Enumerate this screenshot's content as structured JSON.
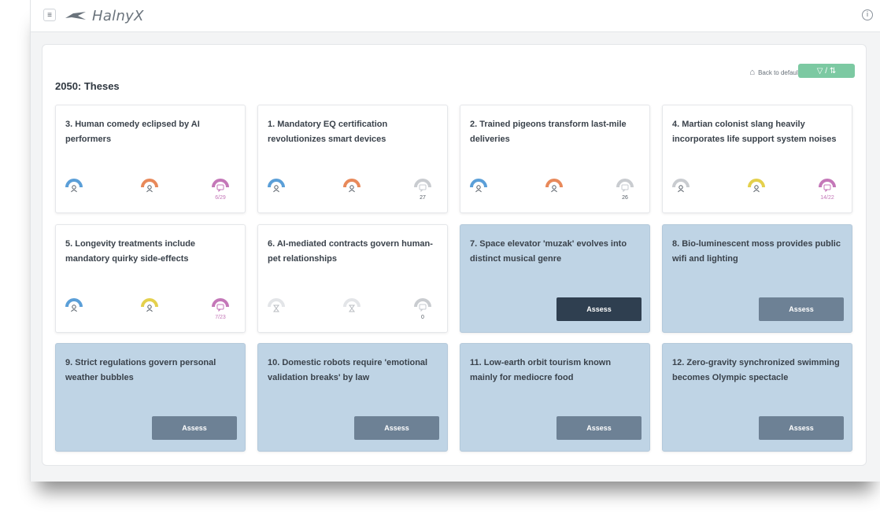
{
  "app": {
    "name": "HalnyX"
  },
  "panel": {
    "title": "2050: Theses",
    "back_label": "Back to default",
    "filter_label": "▽  /  ⇅"
  },
  "colors": {
    "blue": "#5b9fd8",
    "orange": "#e8895a",
    "pink": "#c477b8",
    "gray": "#c9ccd0",
    "yellow": "#e4d04c",
    "light": "#e3e5e8",
    "pending_card": "#bfd4e5",
    "assess": "#6d8195",
    "assess_dark": "#2f3f50",
    "filter": "#7cc9a2"
  },
  "assess_label": "Assess",
  "cards": [
    {
      "text": "3. Human comedy eclipsed by AI performers",
      "state": "assessed",
      "g1": "blue",
      "g2": "orange",
      "g3": "pink",
      "count": "6/29",
      "count_pink": true
    },
    {
      "text": "1. Mandatory EQ certification revolutionizes smart devices",
      "state": "assessed",
      "g1": "blue",
      "g2": "orange",
      "g3": "gray",
      "count": "27",
      "count_pink": false
    },
    {
      "text": "2. Trained pigeons transform last-mile deliveries",
      "state": "assessed",
      "g1": "blue",
      "g2": "orange",
      "g3": "gray",
      "count": "26",
      "count_pink": false
    },
    {
      "text": "4. Martian colonist slang heavily incorporates life support system noises",
      "state": "assessed",
      "g1": "gray",
      "g2": "yellow",
      "g3": "pink",
      "count": "14/22",
      "count_pink": true
    },
    {
      "text": "5. Longevity treatments include mandatory quirky side-effects",
      "state": "assessed",
      "g1": "blue",
      "g2": "yellow",
      "g3": "pink",
      "count": "7/23",
      "count_pink": true
    },
    {
      "text": "6. AI-mediated contracts govern human-pet relationships",
      "state": "empty",
      "g1": "light",
      "g2": "light",
      "g3": "gray",
      "count": "0",
      "count_pink": false
    },
    {
      "text": "7. Space elevator 'muzak' evolves into distinct musical genre",
      "state": "pending",
      "dark": true
    },
    {
      "text": "8. Bio-luminescent moss provides public wifi and lighting",
      "state": "pending",
      "dark": false
    },
    {
      "text": "9. Strict regulations govern personal weather bubbles",
      "state": "pending",
      "dark": false
    },
    {
      "text": "10. Domestic robots require 'emotional validation breaks' by law",
      "state": "pending",
      "dark": false
    },
    {
      "text": "11. Low-earth orbit tourism known mainly for mediocre food",
      "state": "pending",
      "dark": false
    },
    {
      "text": "12. Zero-gravity synchronized swimming becomes Olympic spectacle",
      "state": "pending",
      "dark": false
    }
  ]
}
